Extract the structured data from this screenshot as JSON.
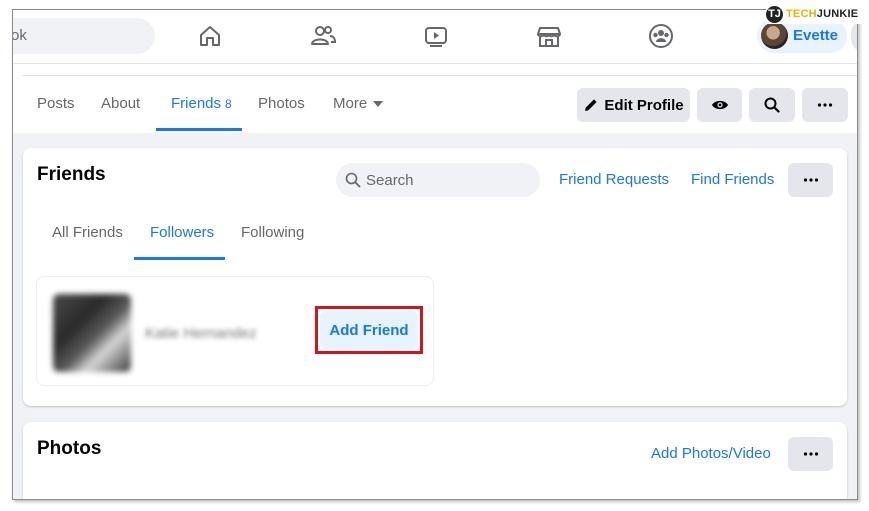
{
  "topbar": {
    "search_text": "ok",
    "nav_icons": [
      "home-icon",
      "friends-icon",
      "watch-icon",
      "marketplace-icon",
      "groups-icon"
    ],
    "user_name": "Evette"
  },
  "logo": {
    "badge": "TJ",
    "part1": "TECH",
    "part2": "JUNKIE"
  },
  "profile_tabs": {
    "posts": "Posts",
    "about": "About",
    "friends": "Friends",
    "friends_count": "8",
    "photos": "Photos",
    "more": "More",
    "edit_profile": "Edit Profile"
  },
  "friends_card": {
    "title": "Friends",
    "search_placeholder": "Search",
    "friend_requests": "Friend Requests",
    "find_friends": "Find Friends",
    "tabs": {
      "all_friends": "All Friends",
      "followers": "Followers",
      "following": "Following"
    },
    "follower": {
      "name": "Katie Hernandez",
      "add_friend": "Add Friend"
    }
  },
  "photos_card": {
    "title": "Photos",
    "add_photos": "Add Photos/Video"
  },
  "colors": {
    "accent": "#1877f2",
    "highlight_outline": "#d3141b",
    "page_bg": "#f0f2f5"
  }
}
